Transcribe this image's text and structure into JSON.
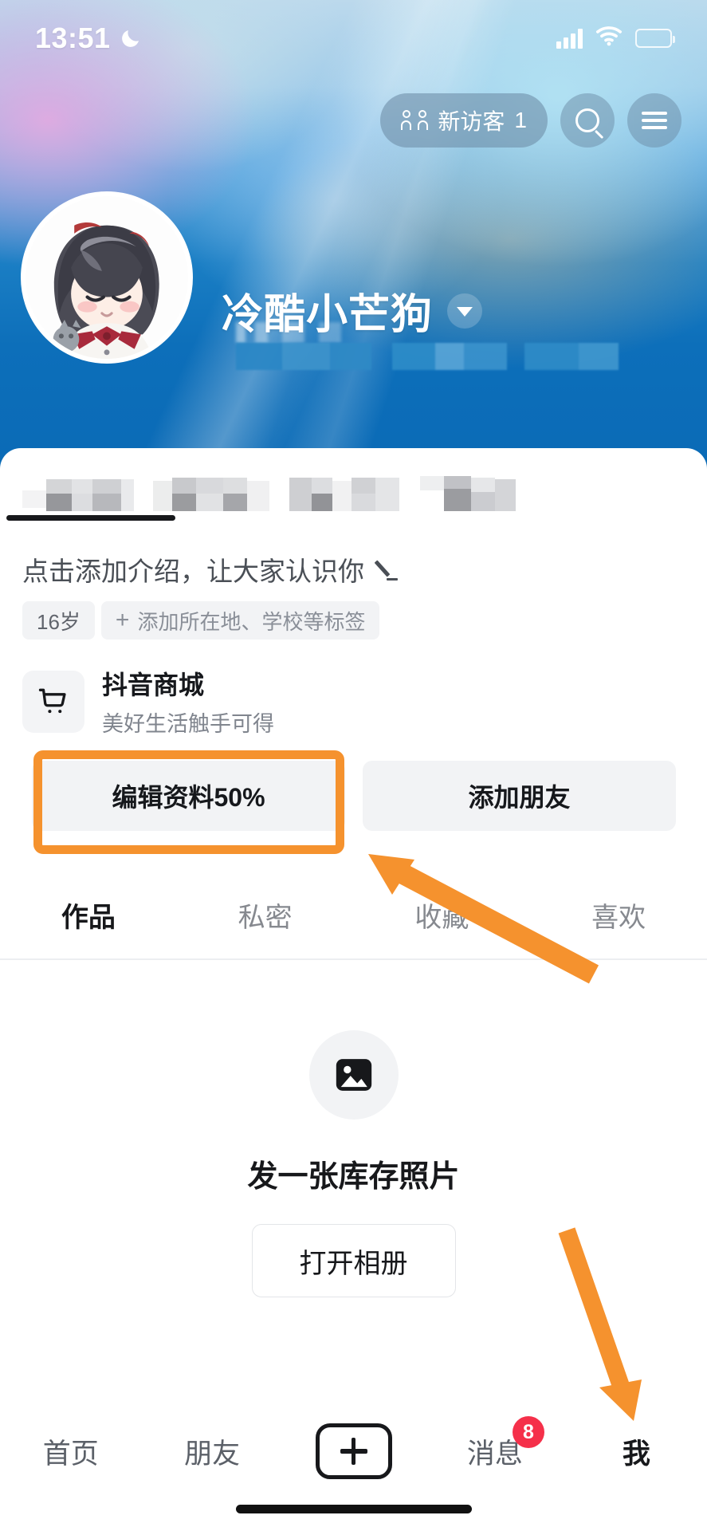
{
  "status_bar": {
    "time": "13:51",
    "moon_icon": "moon-icon",
    "signal_icon": "signal-bars-icon",
    "wifi_icon": "wifi-icon",
    "battery_icon": "battery-low-icon"
  },
  "header": {
    "visitor_pill": {
      "icon": "two-people-icon",
      "label": "新访客",
      "count": "1"
    },
    "search_icon": "search-icon",
    "menu_icon": "hamburger-menu-icon"
  },
  "profile": {
    "avatar": "user-avatar",
    "name": "冷酷小芒狗",
    "name_caret_icon": "chevron-down-icon",
    "sub_info_blurred": "",
    "stats_blurred": [
      "",
      "",
      "",
      ""
    ],
    "bio_placeholder": "点击添加介绍，让大家认识你",
    "bio_edit_icon": "pencil-icon",
    "tags": [
      {
        "label": "16岁",
        "type": "value"
      },
      {
        "label": "添加所在地、学校等标签",
        "type": "add",
        "icon": "plus-icon"
      }
    ]
  },
  "shop": {
    "icon": "shopping-cart-icon",
    "title": "抖音商城",
    "subtitle": "美好生活触手可得"
  },
  "actions": {
    "edit_profile": "编辑资料50%",
    "add_friend": "添加朋友"
  },
  "tabs": [
    {
      "label": "作品",
      "active": true
    },
    {
      "label": "私密",
      "active": false
    },
    {
      "label": "收藏",
      "active": false
    },
    {
      "label": "喜欢",
      "active": false
    }
  ],
  "empty_state": {
    "icon": "image-placeholder-icon",
    "title": "发一张库存照片",
    "button": "打开相册"
  },
  "bottom_nav": [
    {
      "label": "首页",
      "active": false
    },
    {
      "label": "朋友",
      "active": false
    },
    {
      "label": "",
      "icon": "plus-create-icon",
      "active": false
    },
    {
      "label": "消息",
      "badge": "8",
      "active": false
    },
    {
      "label": "我",
      "active": true
    }
  ],
  "annotations": {
    "accent_color": "#F5922E",
    "arrow_to_edit_profile": "arrow-pointing-to-edit-profile-button",
    "arrow_to_me_tab": "arrow-pointing-to-me-tab",
    "highlight_box_target": "编辑资料50%"
  },
  "colors": {
    "banner_blue": "#0d6fba",
    "accent_orange": "#F5922E",
    "badge_red": "#F5304A",
    "text_primary": "#17181b",
    "text_secondary": "#80858e",
    "chip_bg": "#f2f3f5"
  }
}
